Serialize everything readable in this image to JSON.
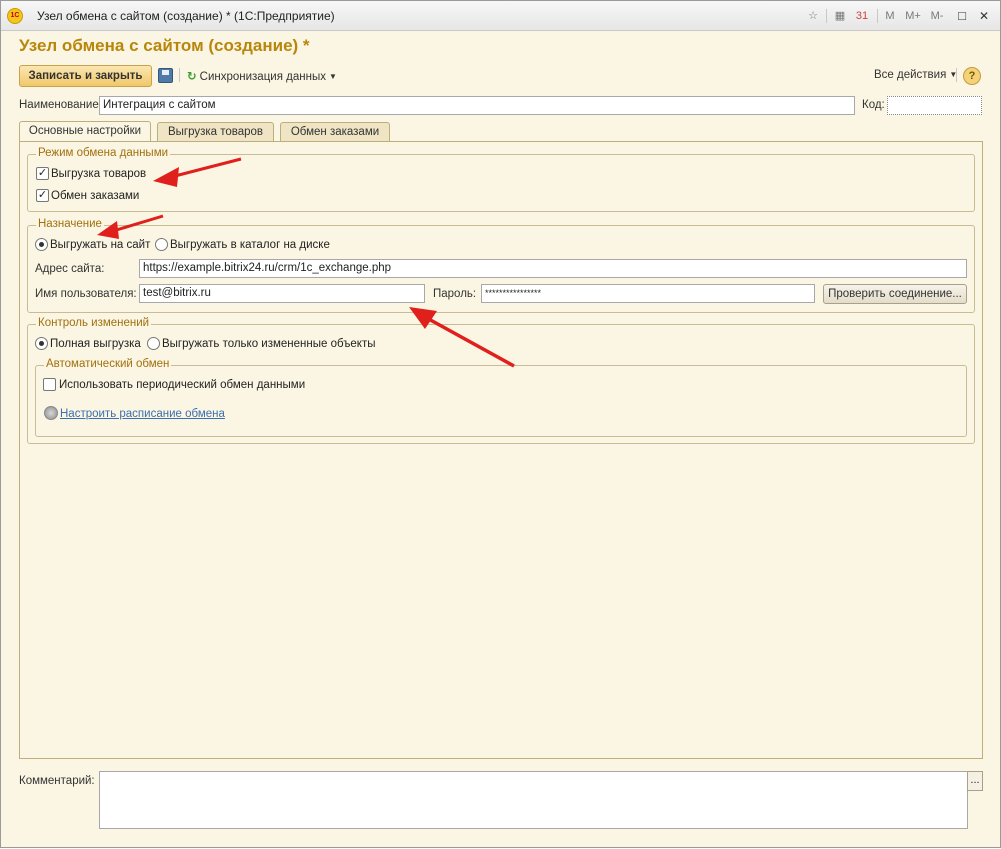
{
  "window": {
    "title": "Узел обмена с сайтом (создание) * (1С:Предприятие)",
    "logo_text": "1С"
  },
  "titlebar_icons": {
    "m": "M",
    "m_plus": "M+",
    "m_minus": "M-",
    "minimize": "–",
    "maximize": "□",
    "close": "✕"
  },
  "form": {
    "title": "Узел обмена с сайтом (создание) *"
  },
  "toolbar": {
    "save_close_label": "Записать и закрыть",
    "sync_label": "Синхронизация данных",
    "all_actions_label": "Все действия",
    "help_label": "?"
  },
  "header_fields": {
    "name_label": "Наименование:",
    "name_value": "Интеграция с сайтом",
    "code_label": "Код:",
    "code_value": ""
  },
  "tabs": [
    {
      "label": "Основные настройки",
      "active": true
    },
    {
      "label": "Выгрузка товаров",
      "active": false
    },
    {
      "label": "Обмен заказами",
      "active": false
    }
  ],
  "exchange_mode": {
    "title": "Режим обмена данными",
    "export_goods_label": "Выгрузка товаров",
    "export_goods_checked": true,
    "orders_label": "Обмен заказами",
    "orders_checked": true
  },
  "destination": {
    "title": "Назначение",
    "to_site_label": "Выгружать на сайт",
    "to_disk_label": "Выгружать в каталог на диске",
    "selected": "to_site",
    "site_address_label": "Адрес сайта:",
    "site_address_value": "https://example.bitrix24.ru/crm/1c_exchange.php",
    "username_label": "Имя пользователя:",
    "username_value": "test@bitrix.ru",
    "password_label": "Пароль:",
    "password_value": "****************",
    "check_connection_label": "Проверить соединение..."
  },
  "change_control": {
    "title": "Контроль изменений",
    "full_export_label": "Полная выгрузка",
    "changed_only_label": "Выгружать только измененные объекты",
    "selected": "full"
  },
  "auto_exchange": {
    "title": "Автоматический обмен",
    "periodic_label": "Использовать периодический обмен данными",
    "periodic_checked": false,
    "schedule_link": "Настроить расписание обмена"
  },
  "comment": {
    "label": "Комментарий:",
    "value": "",
    "dots_label": "..."
  },
  "colors": {
    "form_title": "#b8860b",
    "group_title": "#a0700e",
    "arrow": "#e0201c",
    "link": "#3b6fb0"
  }
}
